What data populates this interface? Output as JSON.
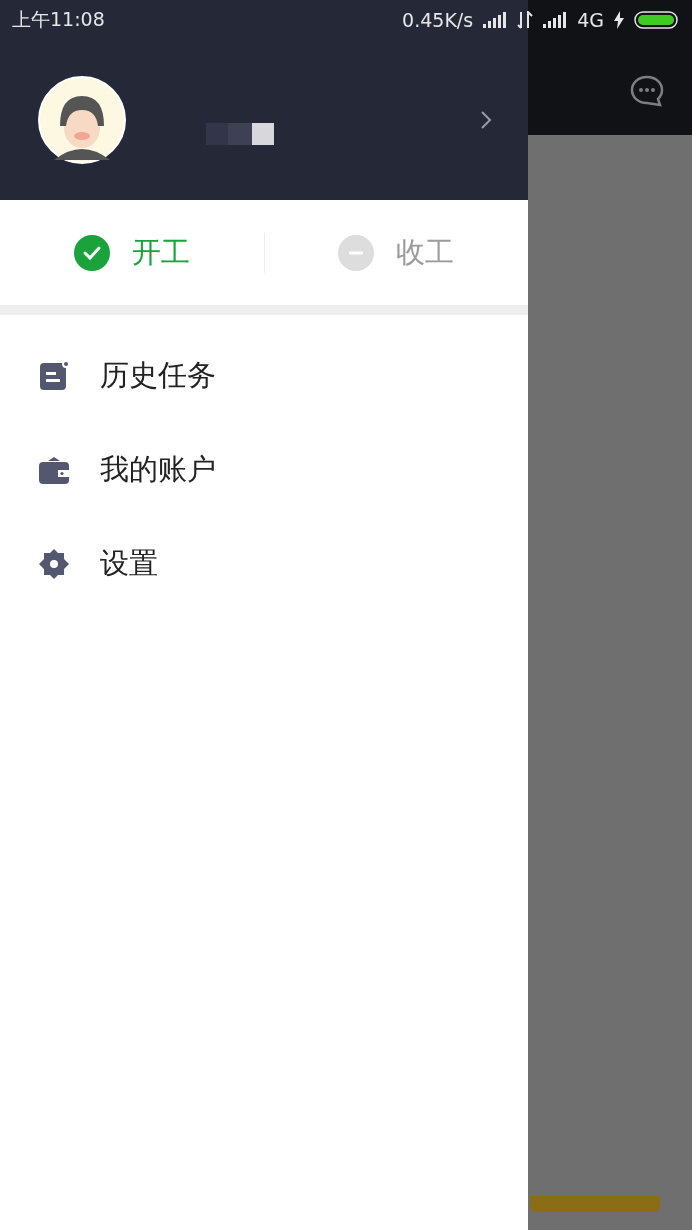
{
  "status_bar": {
    "time": "上午11:08",
    "speed": "0.45K/s",
    "network": "4G"
  },
  "drawer": {
    "shift_toggle": [
      {
        "label": "开工",
        "kind": "start",
        "selected": true
      },
      {
        "label": "收工",
        "kind": "stop",
        "selected": false
      }
    ],
    "menu": [
      {
        "label": "历史任务",
        "kind": "history"
      },
      {
        "label": "我的账户",
        "kind": "wallet"
      },
      {
        "label": "设置",
        "kind": "settings"
      }
    ]
  }
}
